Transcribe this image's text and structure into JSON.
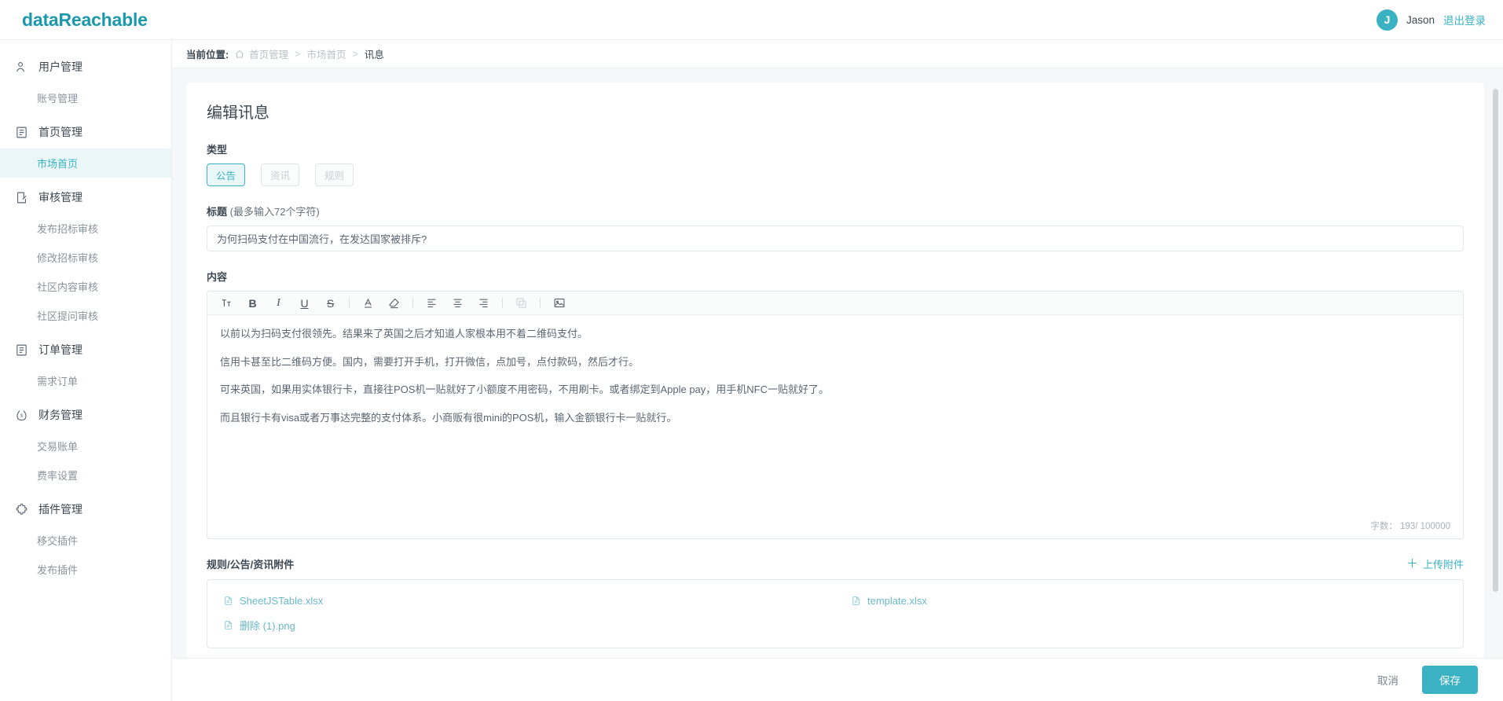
{
  "topbar": {
    "brand": "dataReachable",
    "avatar_initial": "J",
    "username": "Jason",
    "logout_label": "退出登录",
    "accent_color": "#3ab2c4",
    "brand_color": "#1b98ab"
  },
  "sidebar": {
    "groups": [
      {
        "label": "用户管理",
        "icon": "user-icon",
        "children": [
          {
            "label": "账号管理",
            "active": false
          }
        ]
      },
      {
        "label": "首页管理",
        "icon": "list-icon",
        "children": [
          {
            "label": "市场首页",
            "active": true
          }
        ]
      },
      {
        "label": "审核管理",
        "icon": "review-icon",
        "children": [
          {
            "label": "发布招标审核",
            "active": false
          },
          {
            "label": "修改招标审核",
            "active": false
          },
          {
            "label": "社区内容审核",
            "active": false
          },
          {
            "label": "社区提问审核",
            "active": false
          }
        ]
      },
      {
        "label": "订单管理",
        "icon": "order-icon",
        "children": [
          {
            "label": "需求订单",
            "active": false
          }
        ]
      },
      {
        "label": "财务管理",
        "icon": "money-icon",
        "children": [
          {
            "label": "交易账单",
            "active": false
          },
          {
            "label": "费率设置",
            "active": false
          }
        ]
      },
      {
        "label": "插件管理",
        "icon": "puzzle-icon",
        "children": [
          {
            "label": "移交插件",
            "active": false
          },
          {
            "label": "发布插件",
            "active": false
          }
        ]
      }
    ]
  },
  "breadcrumb": {
    "label": "当前位置:",
    "items": [
      "首页管理",
      "市场首页"
    ],
    "current": "讯息",
    "separator": ">"
  },
  "form": {
    "title": "编辑讯息",
    "type": {
      "label": "类型",
      "options": [
        {
          "label": "公告",
          "selected": true
        },
        {
          "label": "资讯",
          "selected": false
        },
        {
          "label": "规则",
          "selected": false
        }
      ]
    },
    "title_field": {
      "label": "标题",
      "hint": "(最多输入72个字符)",
      "value": "为何扫码支付在中国流行，在发达国家被排斥?",
      "placeholder": ""
    },
    "content": {
      "label": "内容",
      "toolbar": [
        {
          "name": "font-size-icon",
          "glyph": "Tт",
          "disabled": false
        },
        {
          "name": "bold-icon",
          "glyph": "B",
          "disabled": false
        },
        {
          "name": "italic-icon",
          "glyph": "I",
          "disabled": false
        },
        {
          "name": "underline-icon",
          "glyph": "U",
          "disabled": false
        },
        {
          "name": "strikethrough-icon",
          "glyph": "S",
          "disabled": false
        },
        {
          "name": "text-color-icon",
          "glyph": "A",
          "disabled": false
        },
        {
          "name": "highlight-color-icon",
          "glyph": "",
          "disabled": false
        },
        {
          "name": "align-left-icon",
          "glyph": "",
          "disabled": false
        },
        {
          "name": "align-center-icon",
          "glyph": "",
          "disabled": false
        },
        {
          "name": "align-right-icon",
          "glyph": "",
          "disabled": false
        },
        {
          "name": "duplicate-icon",
          "glyph": "",
          "disabled": true
        },
        {
          "name": "insert-image-icon",
          "glyph": "",
          "disabled": false
        }
      ],
      "paragraphs": [
        "以前以为扫码支付很领先。结果来了英国之后才知道人家根本用不着二维码支付。",
        "信用卡甚至比二维码方便。国内，需要打开手机，打开微信，点加号，点付款码，然后才行。",
        "可来英国，如果用实体银行卡，直接往POS机一贴就好了小额度不用密码，不用刷卡。或者绑定到Apple pay，用手机NFC一贴就好了。",
        "而且银行卡有visa或者万事达完整的支付体系。小商贩有很mini的POS机，输入金额银行卡一贴就行。"
      ],
      "counter": "字数： 193/ 100000"
    },
    "attachments": {
      "label": "规则/公告/资讯附件",
      "upload_label": "上传附件",
      "files": [
        "SheetJSTable.xlsx",
        "template.xlsx",
        "删除 (1).png"
      ]
    }
  },
  "footer": {
    "cancel_label": "取消",
    "save_label": "保存"
  }
}
